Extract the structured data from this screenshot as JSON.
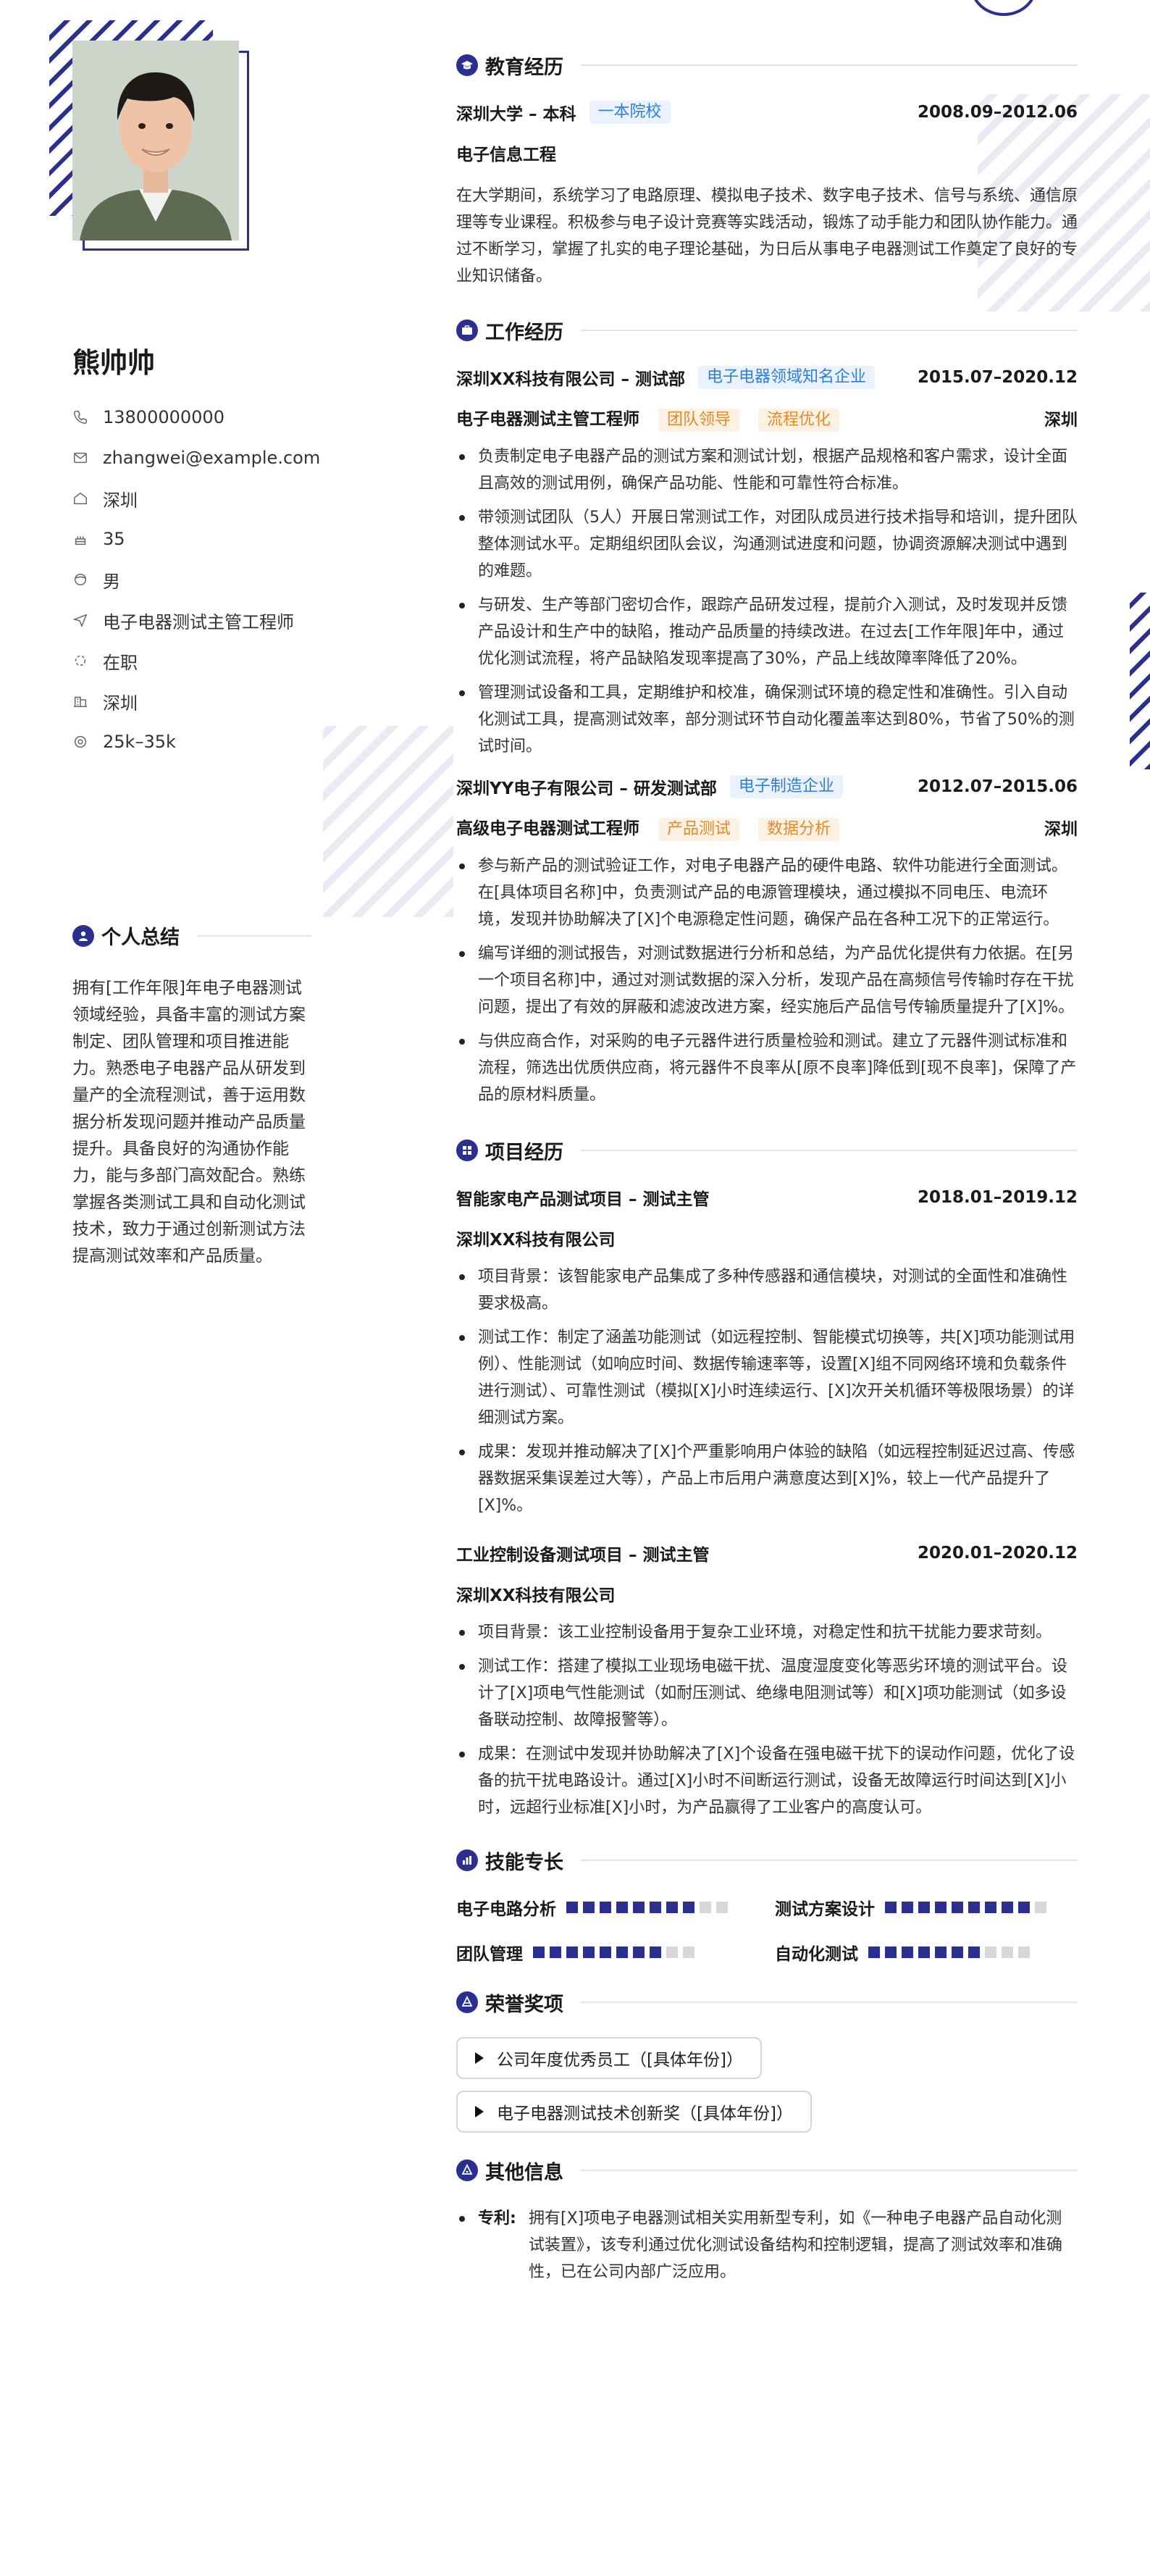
{
  "profile": {
    "name": "熊帅帅",
    "contacts": [
      {
        "icon": "phone-icon",
        "text": "13800000000"
      },
      {
        "icon": "mail-icon",
        "text": "zhangwei@example.com"
      },
      {
        "icon": "home-icon",
        "text": "深圳"
      },
      {
        "icon": "age-icon",
        "text": "35"
      },
      {
        "icon": "gender-icon",
        "text": "男"
      },
      {
        "icon": "target-icon",
        "text": "电子电器测试主管工程师"
      },
      {
        "icon": "status-icon",
        "text": "在职"
      },
      {
        "icon": "city-icon",
        "text": "深圳"
      },
      {
        "icon": "salary-icon",
        "text": "25k–35k"
      }
    ]
  },
  "summary": {
    "title": "个人总结",
    "text": "拥有[工作年限]年电子电器测试领域经验，具备丰富的测试方案制定、团队管理和项目推进能力。熟悉电子电器产品从研发到量产的全流程测试，善于运用数据分析发现问题并推动产品质量提升。具备良好的沟通协作能力，能与多部门高效配合。熟练掌握各类测试工具和自动化测试技术，致力于通过创新测试方法提高测试效率和产品质量。"
  },
  "education": {
    "title": "教育经历",
    "school": "深圳大学 – 本科",
    "tag": "一本院校",
    "date": "2008.09–2012.06",
    "major": "电子信息工程",
    "desc": "在大学期间，系统学习了电路原理、模拟电子技术、数字电子技术、信号与系统、通信原理等专业课程。积极参与电子设计竞赛等实践活动，锻炼了动手能力和团队协作能力。通过不断学习，掌握了扎实的电子理论基础，为日后从事电子电器测试工作奠定了良好的专业知识储备。"
  },
  "work": {
    "title": "工作经历",
    "jobs": [
      {
        "company": "深圳XX科技有限公司 – 测试部",
        "company_tag": "电子电器领域知名企业",
        "date": "2015.07–2020.12",
        "role": "电子电器测试主管工程师",
        "role_tags": [
          "团队领导",
          "流程优化"
        ],
        "city": "深圳",
        "bullets": [
          "负责制定电子电器产品的测试方案和测试计划，根据产品规格和客户需求，设计全面且高效的测试用例，确保产品功能、性能和可靠性符合标准。",
          "带领测试团队（5人）开展日常测试工作，对团队成员进行技术指导和培训，提升团队整体测试水平。定期组织团队会议，沟通测试进度和问题，协调资源解决测试中遇到的难题。",
          "与研发、生产等部门密切合作，跟踪产品研发过程，提前介入测试，及时发现并反馈产品设计和生产中的缺陷，推动产品质量的持续改进。在过去[工作年限]年中，通过优化测试流程，将产品缺陷发现率提高了30%，产品上线故障率降低了20%。",
          "管理测试设备和工具，定期维护和校准，确保测试环境的稳定性和准确性。引入自动化测试工具，提高测试效率，部分测试环节自动化覆盖率达到80%，节省了50%的测试时间。"
        ]
      },
      {
        "company": "深圳YY电子有限公司 – 研发测试部",
        "company_tag": "电子制造企业",
        "date": "2012.07–2015.06",
        "role": "高级电子电器测试工程师",
        "role_tags": [
          "产品测试",
          "数据分析"
        ],
        "city": "深圳",
        "bullets": [
          "参与新产品的测试验证工作，对电子电器产品的硬件电路、软件功能进行全面测试。在[具体项目名称]中，负责测试产品的电源管理模块，通过模拟不同电压、电流环境，发现并协助解决了[X]个电源稳定性问题，确保产品在各种工况下的正常运行。",
          "编写详细的测试报告，对测试数据进行分析和总结，为产品优化提供有力依据。在[另一个项目名称]中，通过对测试数据的深入分析，发现产品在高频信号传输时存在干扰问题，提出了有效的屏蔽和滤波改进方案，经实施后产品信号传输质量提升了[X]%。",
          "与供应商合作，对采购的电子元器件进行质量检验和测试。建立了元器件测试标准和流程，筛选出优质供应商，将元器件不良率从[原不良率]降低到[现不良率]，保障了产品的原材料质量。"
        ]
      }
    ]
  },
  "projects": {
    "title": "项目经历",
    "items": [
      {
        "name": "智能家电产品测试项目 – 测试主管",
        "date": "2018.01–2019.12",
        "company": "深圳XX科技有限公司",
        "bullets": [
          "项目背景：该智能家电产品集成了多种传感器和通信模块，对测试的全面性和准确性要求极高。",
          "测试工作：制定了涵盖功能测试（如远程控制、智能模式切换等，共[X]项功能测试用例）、性能测试（如响应时间、数据传输速率等，设置[X]组不同网络环境和负载条件进行测试）、可靠性测试（模拟[X]小时连续运行、[X]次开关机循环等极限场景）的详细测试方案。",
          "成果：发现并推动解决了[X]个严重影响用户体验的缺陷（如远程控制延迟过高、传感器数据采集误差过大等），产品上市后用户满意度达到[X]%，较上一代产品提升了[X]%。"
        ]
      },
      {
        "name": "工业控制设备测试项目 – 测试主管",
        "date": "2020.01–2020.12",
        "company": "深圳XX科技有限公司",
        "bullets": [
          "项目背景：该工业控制设备用于复杂工业环境，对稳定性和抗干扰能力要求苛刻。",
          "测试工作：搭建了模拟工业现场电磁干扰、温度湿度变化等恶劣环境的测试平台。设计了[X]项电气性能测试（如耐压测试、绝缘电阻测试等）和[X]项功能测试（如多设备联动控制、故障报警等）。",
          "成果：在测试中发现并协助解决了[X]个设备在强电磁干扰下的误动作问题，优化了设备的抗干扰电路设计。通过[X]小时不间断运行测试，设备无故障运行时间达到[X]小时，远超行业标准[X]小时，为产品赢得了工业客户的高度认可。"
        ]
      }
    ]
  },
  "skills": {
    "title": "技能专长",
    "items": [
      {
        "name": "电子电路分析",
        "level": 8,
        "max": 10
      },
      {
        "name": "测试方案设计",
        "level": 9,
        "max": 10
      },
      {
        "name": "团队管理",
        "level": 8,
        "max": 10
      },
      {
        "name": "自动化测试",
        "level": 7,
        "max": 10
      }
    ]
  },
  "awards": {
    "title": "荣誉奖项",
    "items": [
      "公司年度优秀员工（[具体年份]）",
      "电子电器测试技术创新奖（[具体年份]）"
    ]
  },
  "other": {
    "title": "其他信息",
    "items": [
      {
        "key": "专利:",
        "text": "拥有[X]项电子电器测试相关实用新型专利，如《一种电子电器产品自动化测试装置》，该专利通过优化测试设备结构和控制逻辑，提高了测试效率和准确性，已在公司内部广泛应用。"
      }
    ]
  },
  "colors": {
    "accent": "#2b2f8f",
    "tag_blue": "#2f7fd4",
    "tag_orange": "#e08b2a"
  }
}
